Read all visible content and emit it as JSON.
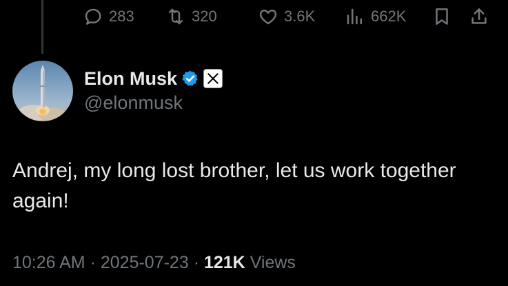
{
  "actions": {
    "replies": "283",
    "reposts": "320",
    "likes": "3.6K",
    "views": "662K"
  },
  "author": {
    "name": "Elon Musk",
    "handle": "@elonmusk",
    "verified": true
  },
  "tweet": {
    "text": "Andrej, my long lost brother, let us work together again!"
  },
  "meta": {
    "time": "10:26 AM",
    "separator1": " · ",
    "date": "2025-07-23",
    "separator2": " · ",
    "views_count": "121K",
    "views_label": "Views"
  },
  "colors": {
    "background": "#000000",
    "text": "#e7e9ea",
    "muted": "#71767b",
    "verified": "#1d9bf0"
  },
  "icons": {
    "reply": "reply-icon",
    "repost": "repost-icon",
    "like": "like-icon",
    "views": "views-icon",
    "bookmark": "bookmark-icon",
    "share": "share-icon",
    "verified": "verified-badge-icon",
    "affiliate": "x-logo-icon"
  }
}
